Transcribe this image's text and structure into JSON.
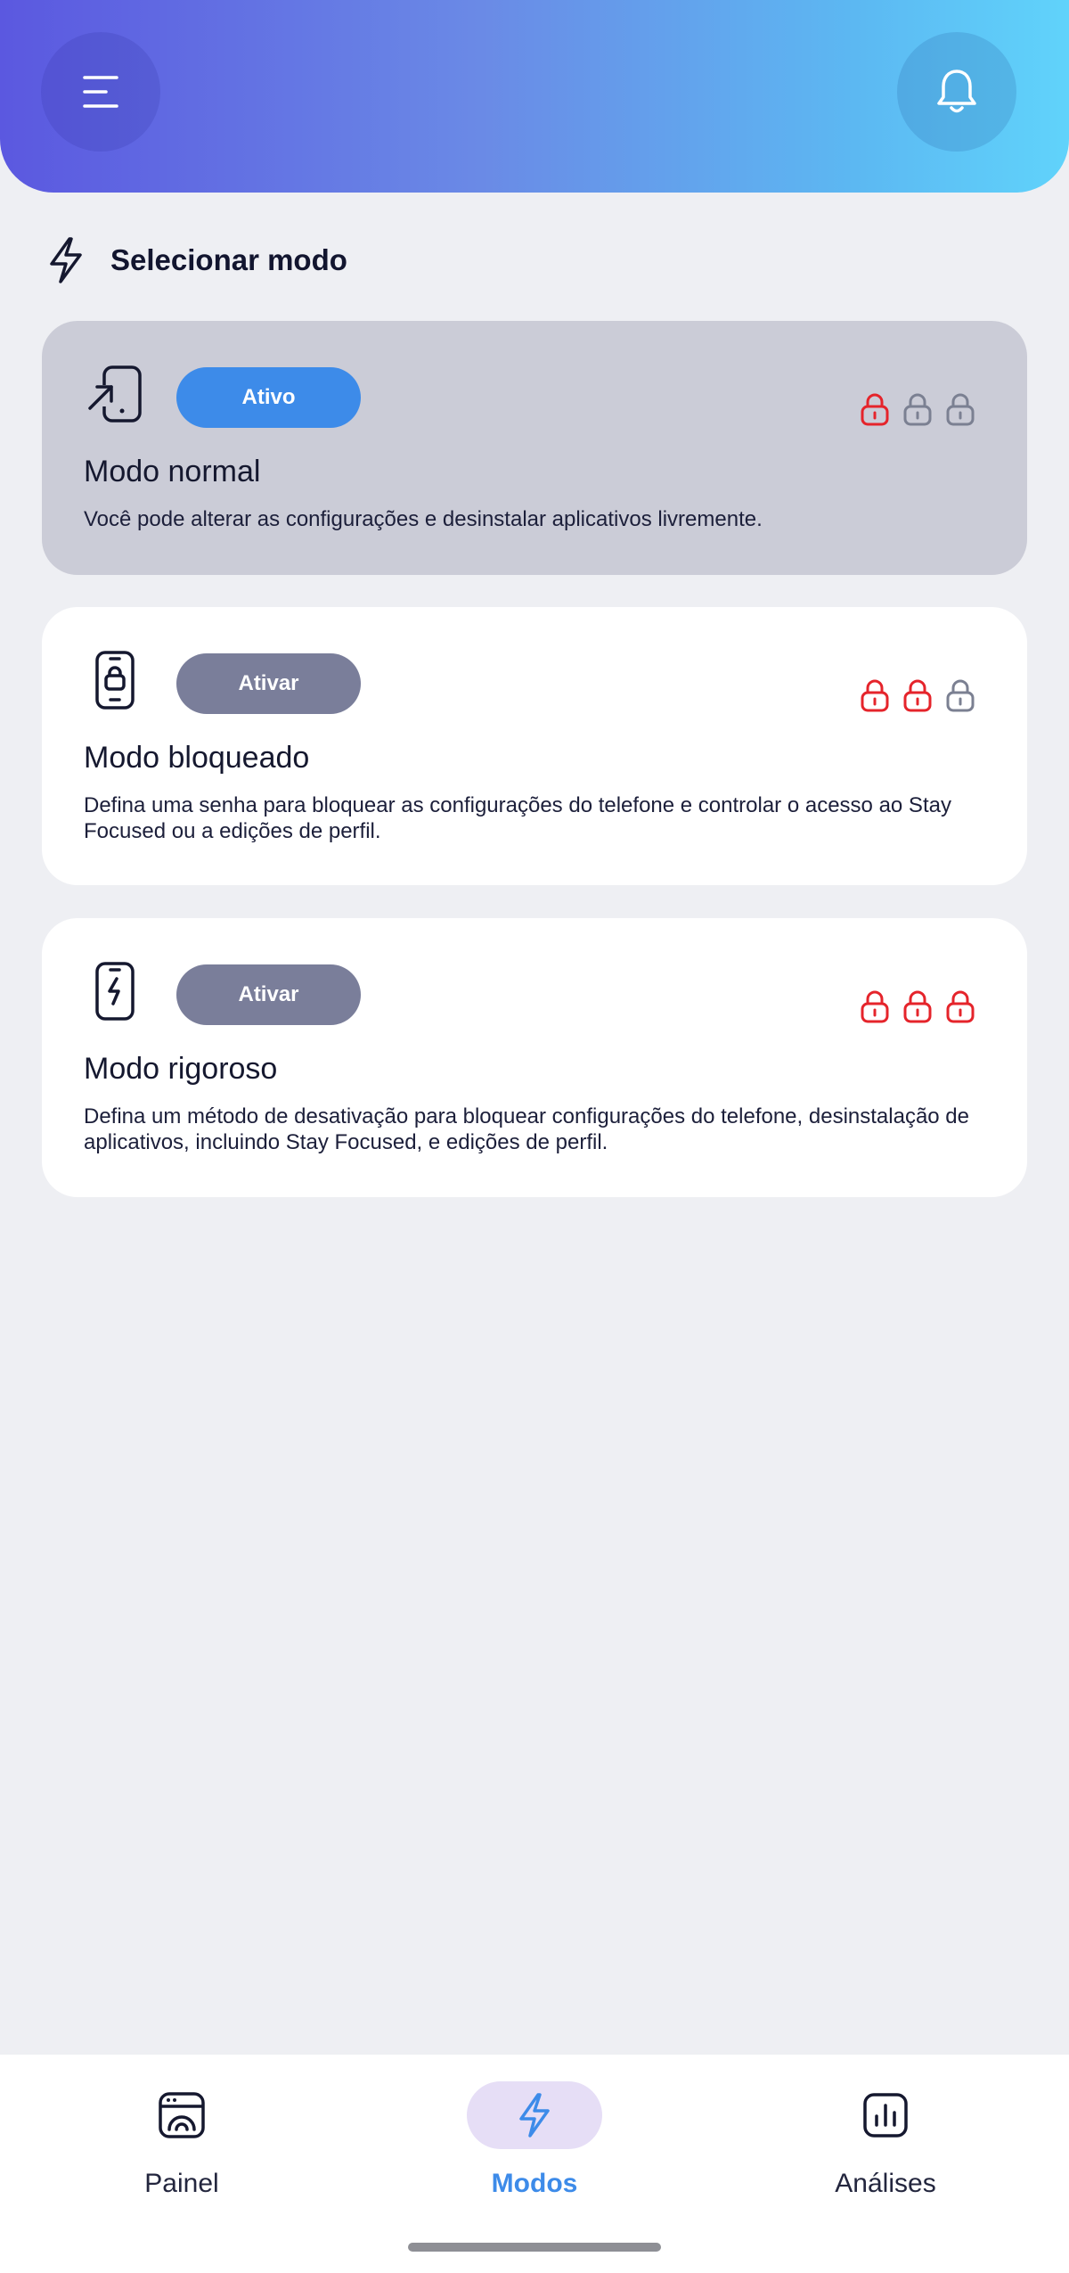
{
  "header": {
    "menu_icon": "menu-icon",
    "bell_icon": "bell-icon",
    "gradient": [
      "#5b58e0",
      "#60d3fb"
    ]
  },
  "section": {
    "icon": "lightning-icon",
    "title": "Selecionar modo"
  },
  "modes": [
    {
      "icon": "phone-exit-icon",
      "button_label": "Ativo",
      "active": true,
      "name": "Modo normal",
      "description": "Você pode alterar as configurações e desinstalar aplicativos livremente.",
      "locks_active": 1
    },
    {
      "icon": "phone-lock-icon",
      "button_label": "Ativar",
      "active": false,
      "name": "Modo bloqueado",
      "description": "Defina uma senha para bloquear as configurações do telefone e controlar o acesso ao Stay Focused ou a edições de perfil.",
      "locks_active": 2
    },
    {
      "icon": "phone-bolt-icon",
      "button_label": "Ativar",
      "active": false,
      "name": "Modo rigoroso",
      "description": "Defina um método de desativação para bloquear configurações do telefone, desinstalação de aplicativos, incluindo Stay Focused, e edições de perfil.",
      "locks_active": 3
    }
  ],
  "colors": {
    "accent": "#3d8be9",
    "inactive_button": "#7a7e9a",
    "lock_on": "#e5242b",
    "lock_off": "#7b8092",
    "active_card": "#cbccd7"
  },
  "nav": {
    "items": [
      {
        "label": "Painel",
        "icon": "dashboard-icon",
        "selected": false
      },
      {
        "label": "Modos",
        "icon": "lightning-icon",
        "selected": true
      },
      {
        "label": "Análises",
        "icon": "chart-icon",
        "selected": false
      }
    ]
  }
}
